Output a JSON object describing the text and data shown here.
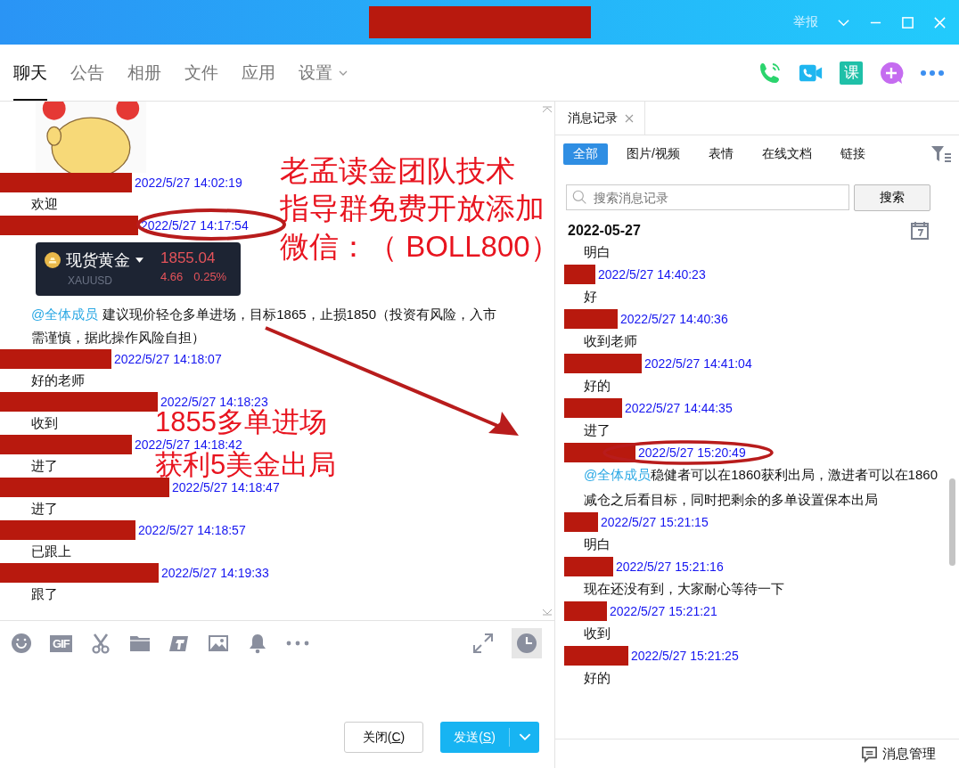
{
  "title_bar": {
    "report": "举报"
  },
  "tabs": [
    {
      "label": "聊天",
      "selected": true
    },
    {
      "label": "公告",
      "selected": false
    },
    {
      "label": "相册",
      "selected": false
    },
    {
      "label": "文件",
      "selected": false
    },
    {
      "label": "应用",
      "selected": false
    },
    {
      "label": "设置",
      "selected": false,
      "dropdown": true
    }
  ],
  "header_actions": {
    "course_label": "课"
  },
  "chat": {
    "messages": [
      {
        "time": "2022/5/27 14:02:19",
        "content": [
          {
            "kind": "text",
            "text": "欢迎"
          }
        ]
      },
      {
        "time": "2022/5/27 14:17:54",
        "content": [
          {
            "kind": "ticker",
            "name": "现货黄金",
            "symbol": "XAUUSD",
            "price": "1855.04",
            "change": "4.66",
            "percent": "0.25%"
          },
          {
            "kind": "text",
            "mention": "@全体成员",
            "text": "建议现价轻仓多单进场，目标1865，止损1850（投资有风险，入市需谨慎，据此操作风险自担）"
          }
        ]
      },
      {
        "time": "2022/5/27 14:18:07",
        "content": [
          {
            "kind": "text",
            "text": "好的老师"
          }
        ]
      },
      {
        "time": "2022/5/27 14:18:23",
        "content": [
          {
            "kind": "text",
            "text": "收到"
          }
        ]
      },
      {
        "time": "2022/5/27 14:18:42",
        "content": [
          {
            "kind": "text",
            "text": "进了"
          }
        ]
      },
      {
        "time": "2022/5/27 14:18:47",
        "content": [
          {
            "kind": "text",
            "text": "进了"
          }
        ]
      },
      {
        "time": "2022/5/27 14:18:57",
        "content": [
          {
            "kind": "text",
            "text": "已跟上"
          }
        ]
      },
      {
        "time": "2022/5/27 14:19:33",
        "content": [
          {
            "kind": "text",
            "text": "跟了"
          }
        ]
      }
    ],
    "toolbar": {
      "gif_label": "GIF"
    },
    "close_button": {
      "before": "关闭(",
      "key": "C",
      "after": ")"
    },
    "send_button": {
      "before": "发送(",
      "key": "S",
      "after": ")"
    }
  },
  "history": {
    "tab": "消息记录",
    "filters": [
      {
        "label": "全部",
        "selected": true
      },
      {
        "label": "图片/视频",
        "selected": false
      },
      {
        "label": "表情",
        "selected": false
      },
      {
        "label": "在线文档",
        "selected": false
      },
      {
        "label": "链接",
        "selected": false
      }
    ],
    "search": {
      "placeholder": "搜索消息记录",
      "button": "搜索"
    },
    "date": "2022-05-27",
    "messages": [
      {
        "text": "明白"
      },
      {
        "time": "2022/5/27 14:40:23",
        "text": "好"
      },
      {
        "time": "2022/5/27 14:40:36",
        "text": "收到老师"
      },
      {
        "time": "2022/5/27 14:41:04",
        "text": "好的"
      },
      {
        "time": "2022/5/27 14:44:35",
        "text": "进了"
      },
      {
        "time": "2022/5/27 15:20:49",
        "mention": "@全体成员",
        "text": "稳健者可以在1860获利出局，激进者可以在1860减仓之后看目标，同时把剩余的多单设置保本出局"
      },
      {
        "time": "2022/5/27 15:21:15",
        "text": "明白"
      },
      {
        "time": "2022/5/27 15:21:16",
        "text": "现在还没有到，大家耐心等待一下"
      },
      {
        "time": "2022/5/27 15:21:21",
        "text": "收到"
      },
      {
        "time": "2022/5/27 15:21:25",
        "text": "好的"
      }
    ],
    "manage": "消息管理"
  },
  "annotations": [
    {
      "lines": [
        "老孟读金团队技术",
        "指导群免费开放添加",
        "微信：（ BOLL800）"
      ]
    },
    {
      "lines": [
        "1855多单进场",
        "获利5美金出局"
      ]
    }
  ]
}
